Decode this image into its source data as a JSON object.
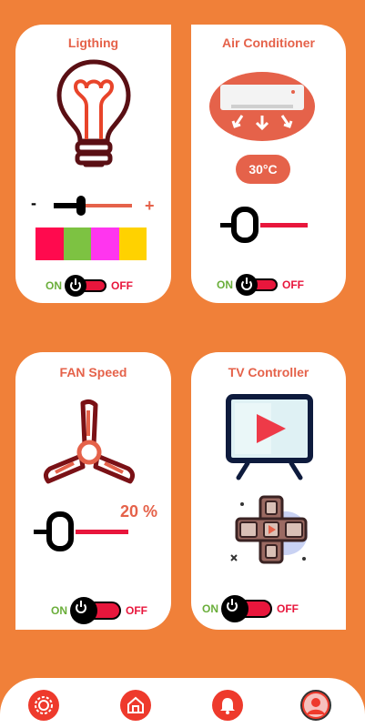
{
  "lighting": {
    "title": "Ligthing",
    "minus_label": "-",
    "plus_label": "+",
    "brightness": 0.35,
    "swatches": [
      "#ff0a4e",
      "#7dc242",
      "#ff35ef",
      "#ffd200"
    ],
    "on_label": "ON",
    "off_label": "OFF"
  },
  "air_conditioner": {
    "title": "Air Conditioner",
    "temperature": "30°C",
    "on_label": "ON",
    "off_label": "OFF"
  },
  "fan": {
    "title": "FAN Speed",
    "speed": "20 %",
    "on_label": "ON",
    "off_label": "OFF"
  },
  "tv": {
    "title": "TV Controller",
    "on_label": "ON",
    "off_label": "OFF"
  },
  "colors": {
    "background": "#f08039",
    "accent": "#e5624a",
    "off": "#e8163c",
    "on": "#6aae3a"
  },
  "nav": {
    "icons": [
      "settings-icon",
      "home-icon",
      "bell-icon",
      "user-icon"
    ]
  }
}
